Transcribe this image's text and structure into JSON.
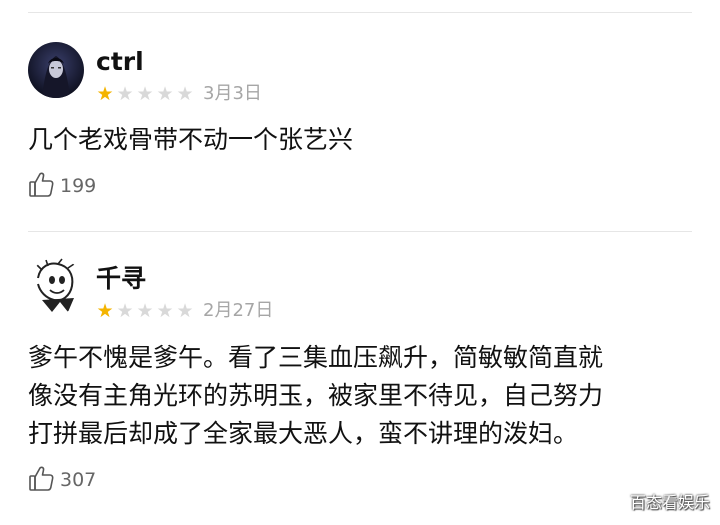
{
  "reviews": [
    {
      "username": "ctrl",
      "avatar": "dark-hooded-figure-avatar",
      "rating": 1,
      "max_rating": 5,
      "date": "3月3日",
      "content_lines": [
        "几个老戏骨带不动一个张艺兴"
      ],
      "like_icon": "thumbs-up-icon",
      "likes": "199"
    },
    {
      "username": "千寻",
      "avatar": "cartoon-sketch-avatar",
      "rating": 1,
      "max_rating": 5,
      "date": "2月27日",
      "content_lines": [
        "爹午不愧是爹午。看了三集血压飙升，简敏敏简直就",
        "像没有主角光环的苏明玉，被家里不待见，自己努力",
        "打拼最后却成了全家最大恶人，蛮不讲理的泼妇。"
      ],
      "like_icon": "thumbs-up-icon",
      "likes": "307"
    }
  ],
  "watermark": "百态看娱乐",
  "colors": {
    "star_filled": "#f4b400",
    "star_empty": "#d9d9d9",
    "meta_text": "#a6a6a6"
  }
}
